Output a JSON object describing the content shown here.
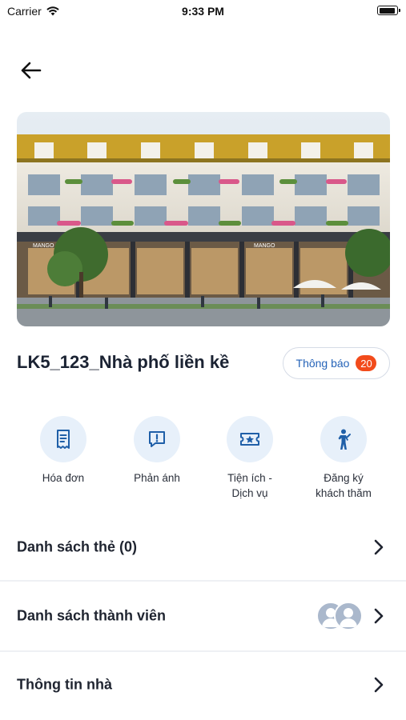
{
  "status_bar": {
    "carrier": "Carrier",
    "time": "9:33 PM"
  },
  "header": {
    "back_icon": "arrow-left-icon"
  },
  "hero": {
    "image_description": "townhouse-street-image",
    "storefront_sign": "MANGO"
  },
  "property": {
    "title": "LK5_123_Nhà phố liền kề"
  },
  "notification": {
    "label": "Thông báo",
    "count": "20"
  },
  "actions": [
    {
      "icon": "receipt-icon",
      "label_line1": "Hóa đơn",
      "label_line2": ""
    },
    {
      "icon": "feedback-icon",
      "label_line1": "Phản ánh",
      "label_line2": ""
    },
    {
      "icon": "ticket-star-icon",
      "label_line1": "Tiện ích -",
      "label_line2": "Dịch vụ"
    },
    {
      "icon": "visitor-icon",
      "label_line1": "Đăng ký",
      "label_line2": "khách thăm"
    }
  ],
  "list": {
    "cards": "Danh sách thẻ (0)",
    "members": "Danh sách thành viên",
    "house_info": "Thông tin nhà"
  },
  "colors": {
    "accent": "#2563b8",
    "badge": "#f24b1b",
    "icon_bg": "#e7f0fa",
    "icon_fg": "#1f5fa8"
  }
}
